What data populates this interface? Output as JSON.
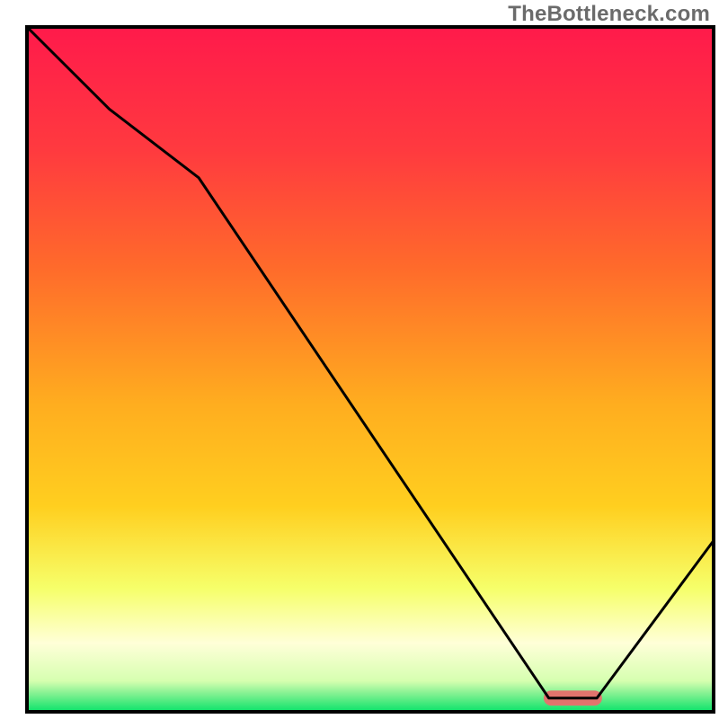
{
  "watermark": "TheBottleneck.com",
  "chart_data": {
    "type": "line",
    "title": "",
    "xlabel": "",
    "ylabel": "",
    "xlim": [
      0,
      100
    ],
    "ylim": [
      0,
      100
    ],
    "grid": false,
    "legend": false,
    "background_gradient": {
      "top": "#ff1a4b",
      "upper_mid": "#ff6a2b",
      "mid": "#ffcf1f",
      "lower_mid": "#f6ff6a",
      "pale": "#ffffd8",
      "bottom": "#09e36a"
    },
    "series": [
      {
        "name": "bottleneck-curve",
        "color": "#000000",
        "x": [
          0,
          12,
          25,
          76,
          83,
          100
        ],
        "y": [
          100,
          88,
          78,
          2,
          2,
          25
        ]
      }
    ],
    "marker": {
      "name": "optimal-range-marker",
      "color": "#e2746d",
      "x_center": 79.5,
      "y": 2,
      "width": 8.5,
      "height": 2.2,
      "rx": 1.1
    },
    "frame": {
      "stroke": "#000000",
      "stroke_width": 4
    }
  }
}
